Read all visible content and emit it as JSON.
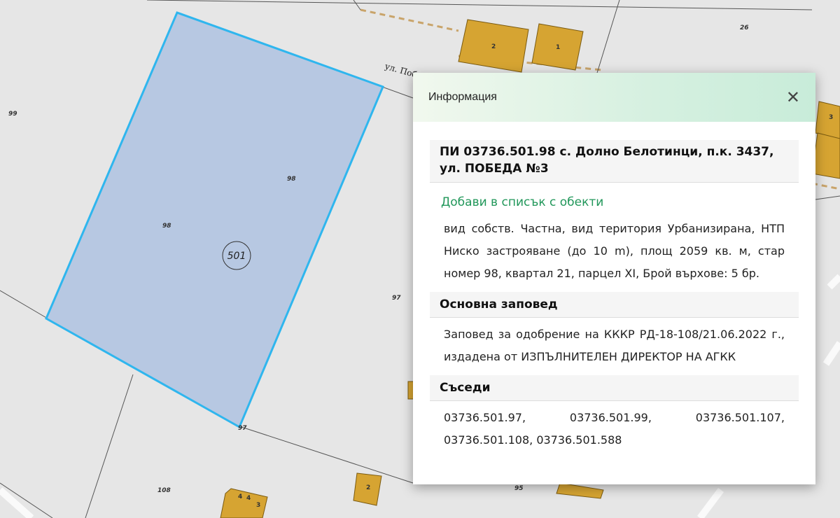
{
  "map": {
    "parcel_id": "501",
    "labels": {
      "l99": "99",
      "l98a": "98",
      "l98b": "98",
      "l97": "97",
      "l97b": "97",
      "l26": "26",
      "l108": "108",
      "l95": "95",
      "street": "ул. Побе"
    },
    "buildings": {
      "b1": "1",
      "b2": "2",
      "b3": "3",
      "b2b": "2",
      "b44": "4",
      "b4b": "4",
      "b3b": "3"
    },
    "colors": {
      "parcel_fill": "#b7c8e2",
      "parcel_border": "#2fb6ee",
      "building": "#d6a432",
      "road_dash": "#c9a46a"
    }
  },
  "popup": {
    "title": "Информация",
    "close_label": "✕",
    "parcel_heading": "ПИ 03736.501.98 с. Долно Белотинци, п.к. 3437, ул. ПОБЕДА №3",
    "add_link": "Добави в списък с обекти",
    "description": "вид собств. Частна, вид територия Урбанизирана, НТП Ниско застрояване (до 10 m), площ 2059 кв. м, стар номер 98, квартал 21, парцел XI, Брой върхове: 5 бр.",
    "order_heading": "Основна заповед",
    "order_text": "Заповед за одобрение на КККР РД-18-108/21.06.2022 г., издадена от ИЗПЪЛНИТЕЛЕН ДИРЕКТОР НА АГКК",
    "neighbors_heading": "Съседи",
    "neighbors_text": "03736.501.97, 03736.501.99, 03736.501.107, 03736.501.108, 03736.501.588"
  }
}
